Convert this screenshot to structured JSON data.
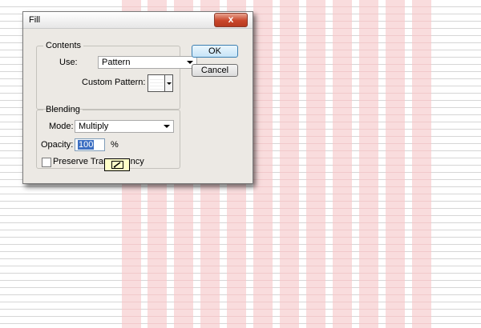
{
  "dialog": {
    "title": "Fill",
    "close_label": "x",
    "contents": {
      "legend": "Contents",
      "use_label": "Use:",
      "use_value": "Pattern",
      "custom_pattern_label": "Custom Pattern:"
    },
    "blending": {
      "legend": "Blending",
      "mode_label": "Mode:",
      "mode_value": "Multiply",
      "opacity_label": "Opacity:",
      "opacity_value": "100",
      "opacity_unit": "%",
      "preserve_label": "Preserve Transparency",
      "preserve_checked": false
    },
    "buttons": {
      "ok": "OK",
      "cancel": "Cancel"
    }
  },
  "colors": {
    "stripe": "#f9dcdd",
    "dialog_bg": "#ece9e4",
    "close_button": "#c9462a",
    "selection": "#3d6fc2"
  },
  "icons": [
    "close-icon",
    "dropdown-arrow-icon",
    "pattern-swatch-icon",
    "pencil-cursor-icon"
  ]
}
